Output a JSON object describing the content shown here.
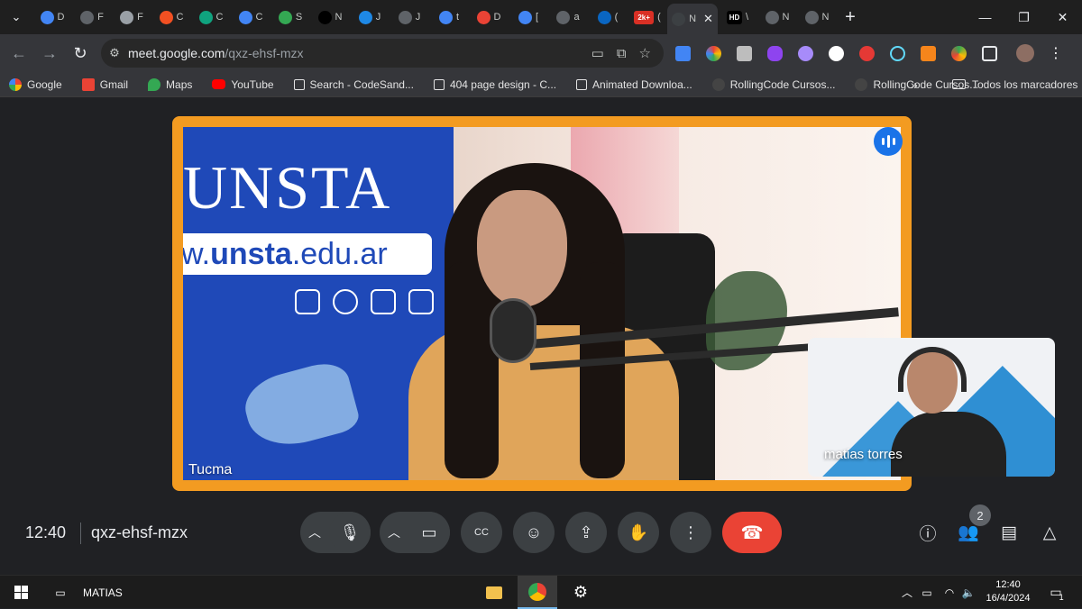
{
  "browser": {
    "tabs": [
      {
        "letter": "D",
        "color": "#4285f4"
      },
      {
        "letter": "F",
        "color": "#5f6368"
      },
      {
        "letter": "F",
        "color": "#9aa0a6"
      },
      {
        "letter": "C",
        "color": "#f25022"
      },
      {
        "letter": "C",
        "color": "#10a37f"
      },
      {
        "letter": "C",
        "color": "#4285f4"
      },
      {
        "letter": "S",
        "color": "#34a853"
      },
      {
        "letter": "N",
        "color": "#000000"
      },
      {
        "letter": "J",
        "color": "#1e88e5"
      },
      {
        "letter": "J",
        "color": "#5f6368"
      },
      {
        "letter": "t",
        "color": "#4285f4"
      },
      {
        "letter": "D",
        "color": "#ea4335"
      },
      {
        "letter": "[",
        "color": "#4285f4"
      },
      {
        "letter": "a",
        "color": "#5f6368"
      },
      {
        "letter": "(",
        "color": "#0a66c2"
      },
      {
        "letter": "(",
        "color": "#d93025",
        "badge": "2k+"
      },
      {
        "letter": "N",
        "color": "#3c4043",
        "active": true
      },
      {
        "letter": "\\",
        "color": "#000000",
        "badge": "HD"
      },
      {
        "letter": "N",
        "color": "#5f6368"
      },
      {
        "letter": "N",
        "color": "#5f6368"
      }
    ],
    "url_host": "meet.google.com",
    "url_path": "/qxz-ehsf-mzx",
    "bookmarks": [
      {
        "label": "Google",
        "icon": "google-icon"
      },
      {
        "label": "Gmail",
        "icon": "gmail-icon"
      },
      {
        "label": "Maps",
        "icon": "maps-icon"
      },
      {
        "label": "YouTube",
        "icon": "youtube-icon"
      },
      {
        "label": "Search - CodeSand...",
        "icon": "page-icon"
      },
      {
        "label": "404 page design - C...",
        "icon": "page-icon"
      },
      {
        "label": "Animated Downloa...",
        "icon": "page-icon"
      },
      {
        "label": "RollingCode Cursos...",
        "icon": "rollingcode-icon"
      },
      {
        "label": "RollingCode Cursos...",
        "icon": "rollingcode-icon"
      }
    ],
    "bookmarks_more": "»",
    "all_bookmarks": "Todos los marcadores"
  },
  "meet": {
    "main_participant": "Tucma",
    "self_participant": "matias torres",
    "backdrop": {
      "logo_text": "UNSTA",
      "url_prefix": "w.",
      "url_bold": "unsta",
      "url_suffix": ".edu.ar"
    },
    "time": "12:40",
    "meeting_code": "qxz-ehsf-mzx",
    "participant_count": "2",
    "accent": "#f39b21",
    "hangup_color": "#ea4335"
  },
  "taskbar": {
    "user": "MATIAS",
    "clock_time": "12:40",
    "clock_date": "16/4/2024",
    "notifications": "1"
  }
}
